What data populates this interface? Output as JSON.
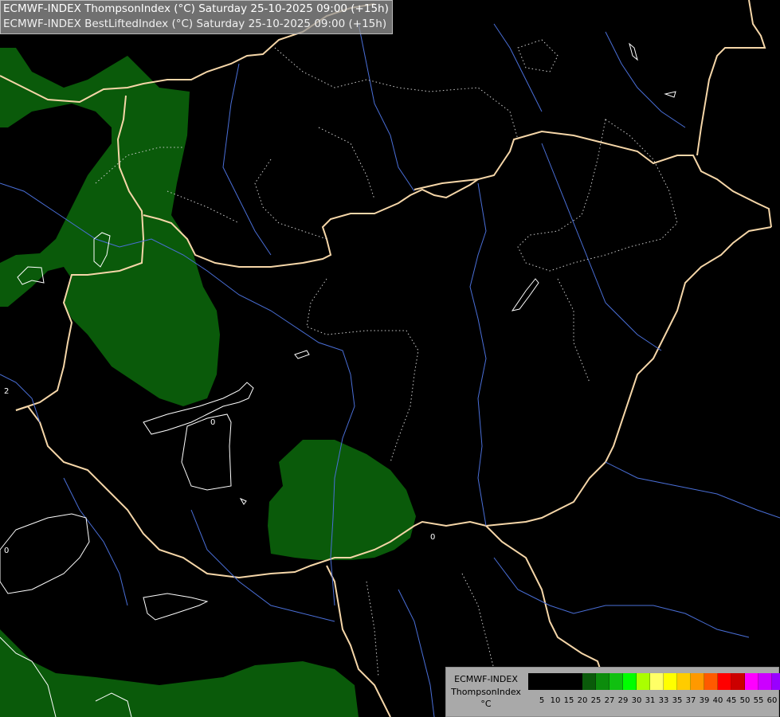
{
  "header": {
    "line1": "ECMWF-INDEX ThompsonIndex (°C) Saturday 25-10-2025 09:00 (+15h)",
    "line2": "ECMWF-INDEX BestLiftedIndex (°C) Saturday 25-10-2025 09:00 (+15h)"
  },
  "contour_labels": {
    "zero_a": "0",
    "zero_b": "0",
    "zero_c": "0",
    "two": "2"
  },
  "legend": {
    "model": "ECMWF-INDEX",
    "variable": "ThompsonIndex",
    "unit": "°C",
    "colors": [
      "#000000",
      "#000000",
      "#000000",
      "#000000",
      "#0a5a0a",
      "#0c8c0c",
      "#10c010",
      "#00ff00",
      "#aaff00",
      "#ffff66",
      "#ffff00",
      "#ffcc00",
      "#ff9900",
      "#ff5a00",
      "#ff0000",
      "#cc0000",
      "#ff00ff",
      "#cc00ff",
      "#9900ff",
      "#6600ff",
      "#0000ff"
    ],
    "ticks": [
      "5",
      "10",
      "15",
      "20",
      "25",
      "27",
      "29",
      "30",
      "31",
      "33",
      "35",
      "37",
      "39",
      "40",
      "45",
      "50",
      "55",
      "60"
    ]
  },
  "colors": {
    "background": "#000000",
    "green_fill": "#0a5a0a",
    "border": "#f5d6a8",
    "rivers": "#4a6fd8",
    "white_contour": "#ffffff"
  }
}
